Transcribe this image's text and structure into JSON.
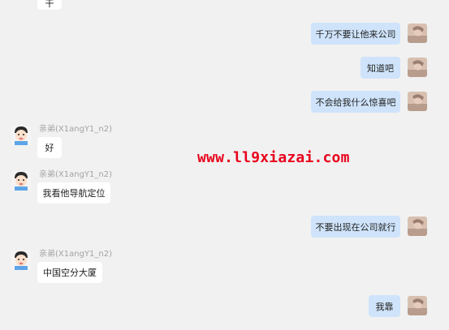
{
  "chat": {
    "contact_name": "亲弟(X1angY1_n2)",
    "messages": [
      {
        "sender": "other",
        "text": "干"
      },
      {
        "sender": "self",
        "text": "千万不要让他来公司"
      },
      {
        "sender": "self",
        "text": "知道吧"
      },
      {
        "sender": "self",
        "text": "不会给我什么惊喜吧"
      },
      {
        "sender": "other",
        "name": "亲弟(X1angY1_n2)",
        "text": "好"
      },
      {
        "sender": "other",
        "name": "亲弟(X1angY1_n2)",
        "text": "我看他导航定位"
      },
      {
        "sender": "self",
        "text": "不要出现在公司就行"
      },
      {
        "sender": "other",
        "name": "亲弟(X1angY1_n2)",
        "text": "中国空分大厦"
      },
      {
        "sender": "self",
        "text": "我靠"
      }
    ]
  },
  "watermark": {
    "text": "www.ll9xiazai.com",
    "color": "#e8001c"
  },
  "colors": {
    "background": "#f1f1f1",
    "self_bubble": "#cfe4fb",
    "other_bubble": "#ffffff",
    "name_text": "#a3a3a3"
  }
}
